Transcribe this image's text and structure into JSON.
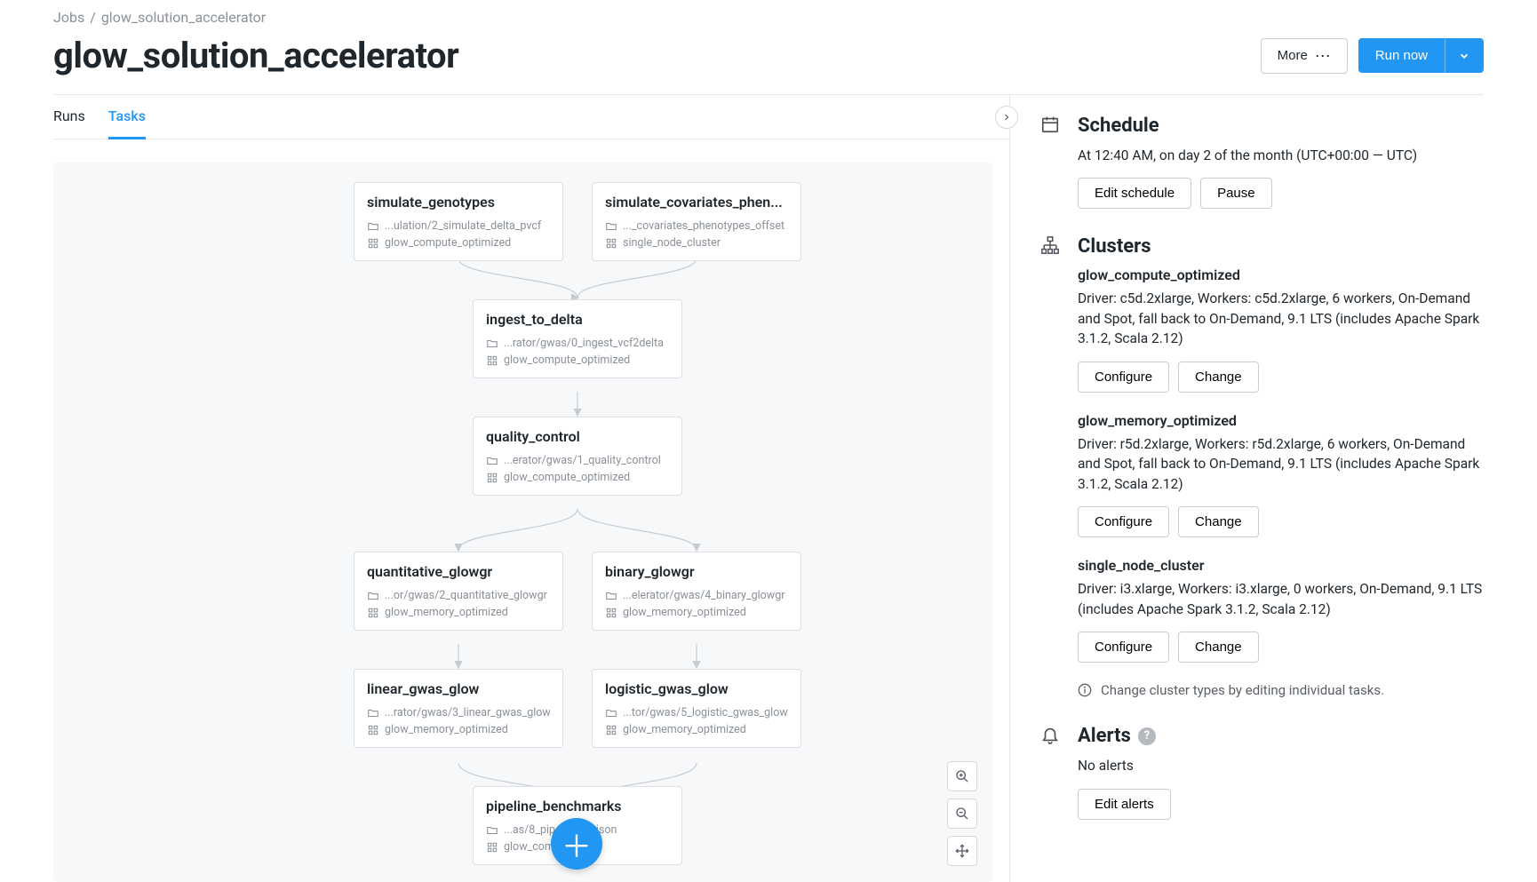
{
  "breadcrumb": {
    "root": "Jobs",
    "sep": "/",
    "current": "glow_solution_accelerator"
  },
  "title": "glow_solution_accelerator",
  "header": {
    "more": "More",
    "run_now": "Run now"
  },
  "tabs": {
    "runs": "Runs",
    "tasks": "Tasks"
  },
  "tasks": [
    {
      "name": "simulate_genotypes",
      "path": "...ulation/2_simulate_delta_pvcf",
      "cluster": "glow_compute_optimized"
    },
    {
      "name": "simulate_covariates_phen...",
      "path": "..._covariates_phenotypes_offset",
      "cluster": "single_node_cluster"
    },
    {
      "name": "ingest_to_delta",
      "path": "...rator/gwas/0_ingest_vcf2delta",
      "cluster": "glow_compute_optimized"
    },
    {
      "name": "quality_control",
      "path": "...erator/gwas/1_quality_control",
      "cluster": "glow_compute_optimized"
    },
    {
      "name": "quantitative_glowgr",
      "path": "...or/gwas/2_quantitative_glowgr",
      "cluster": "glow_memory_optimized"
    },
    {
      "name": "binary_glowgr",
      "path": "...elerator/gwas/4_binary_glowgr",
      "cluster": "glow_memory_optimized"
    },
    {
      "name": "linear_gwas_glow",
      "path": "...rator/gwas/3_linear_gwas_glow",
      "cluster": "glow_memory_optimized"
    },
    {
      "name": "logistic_gwas_glow",
      "path": "...tor/gwas/5_logistic_gwas_glow",
      "cluster": "glow_memory_optimized"
    },
    {
      "name": "pipeline_benchmarks",
      "path": "...as/8_pipe           omparison",
      "cluster": "glow_comp           ed"
    }
  ],
  "schedule": {
    "title": "Schedule",
    "text": "At 12:40 AM, on day 2 of the month (UTC+00:00 — UTC)",
    "edit": "Edit schedule",
    "pause": "Pause"
  },
  "clusters": {
    "title": "Clusters",
    "configure": "Configure",
    "change": "Change",
    "note": "Change cluster types by editing individual tasks.",
    "items": [
      {
        "name": "glow_compute_optimized",
        "desc": "Driver: c5d.2xlarge, Workers: c5d.2xlarge, 6 workers, On-Demand and Spot, fall back to On-Demand, 9.1 LTS (includes Apache Spark 3.1.2, Scala 2.12)"
      },
      {
        "name": "glow_memory_optimized",
        "desc": "Driver: r5d.2xlarge, Workers: r5d.2xlarge, 6 workers, On-Demand and Spot, fall back to On-Demand, 9.1 LTS (includes Apache Spark 3.1.2, Scala 2.12)"
      },
      {
        "name": "single_node_cluster",
        "desc": "Driver: i3.xlarge, Workers: i3.xlarge, 0 workers, On-Demand, 9.1 LTS (includes Apache Spark 3.1.2, Scala 2.12)"
      }
    ]
  },
  "alerts": {
    "title": "Alerts",
    "none": "No alerts",
    "edit": "Edit alerts"
  }
}
